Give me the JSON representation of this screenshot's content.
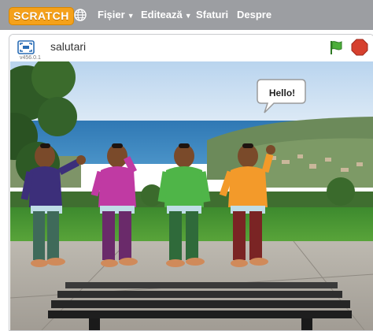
{
  "menubar": {
    "logo": "SCRATCH",
    "items": [
      {
        "label": "Fișier",
        "has_caret": true
      },
      {
        "label": "Editează",
        "has_caret": true
      },
      {
        "label": "Sfaturi",
        "has_caret": false
      },
      {
        "label": "Despre",
        "has_caret": false
      }
    ],
    "language_icon": "globe-icon"
  },
  "stage": {
    "title": "salutari",
    "version": "v456.0.1",
    "fullscreen_icon": "fullscreen-icon",
    "green_flag_icon": "green-flag-icon",
    "stop_icon": "stop-icon",
    "speech": "Hello!",
    "sprites": [
      {
        "name": "boy-1",
        "shirt": "#3c2f7a",
        "pants": "#3f6a5a"
      },
      {
        "name": "boy-2",
        "shirt": "#c03aa3",
        "pants": "#6a2a6a"
      },
      {
        "name": "boy-3",
        "shirt": "#4fb548",
        "pants": "#2f6a3a"
      },
      {
        "name": "boy-4",
        "shirt": "#f39a2a",
        "pants": "#7a2424"
      }
    ]
  },
  "colors": {
    "menubar_bg": "#9c9ea2",
    "logo_orange": "#f5a11a",
    "flag_green": "#4cae3a",
    "stop_red": "#d6402e"
  }
}
